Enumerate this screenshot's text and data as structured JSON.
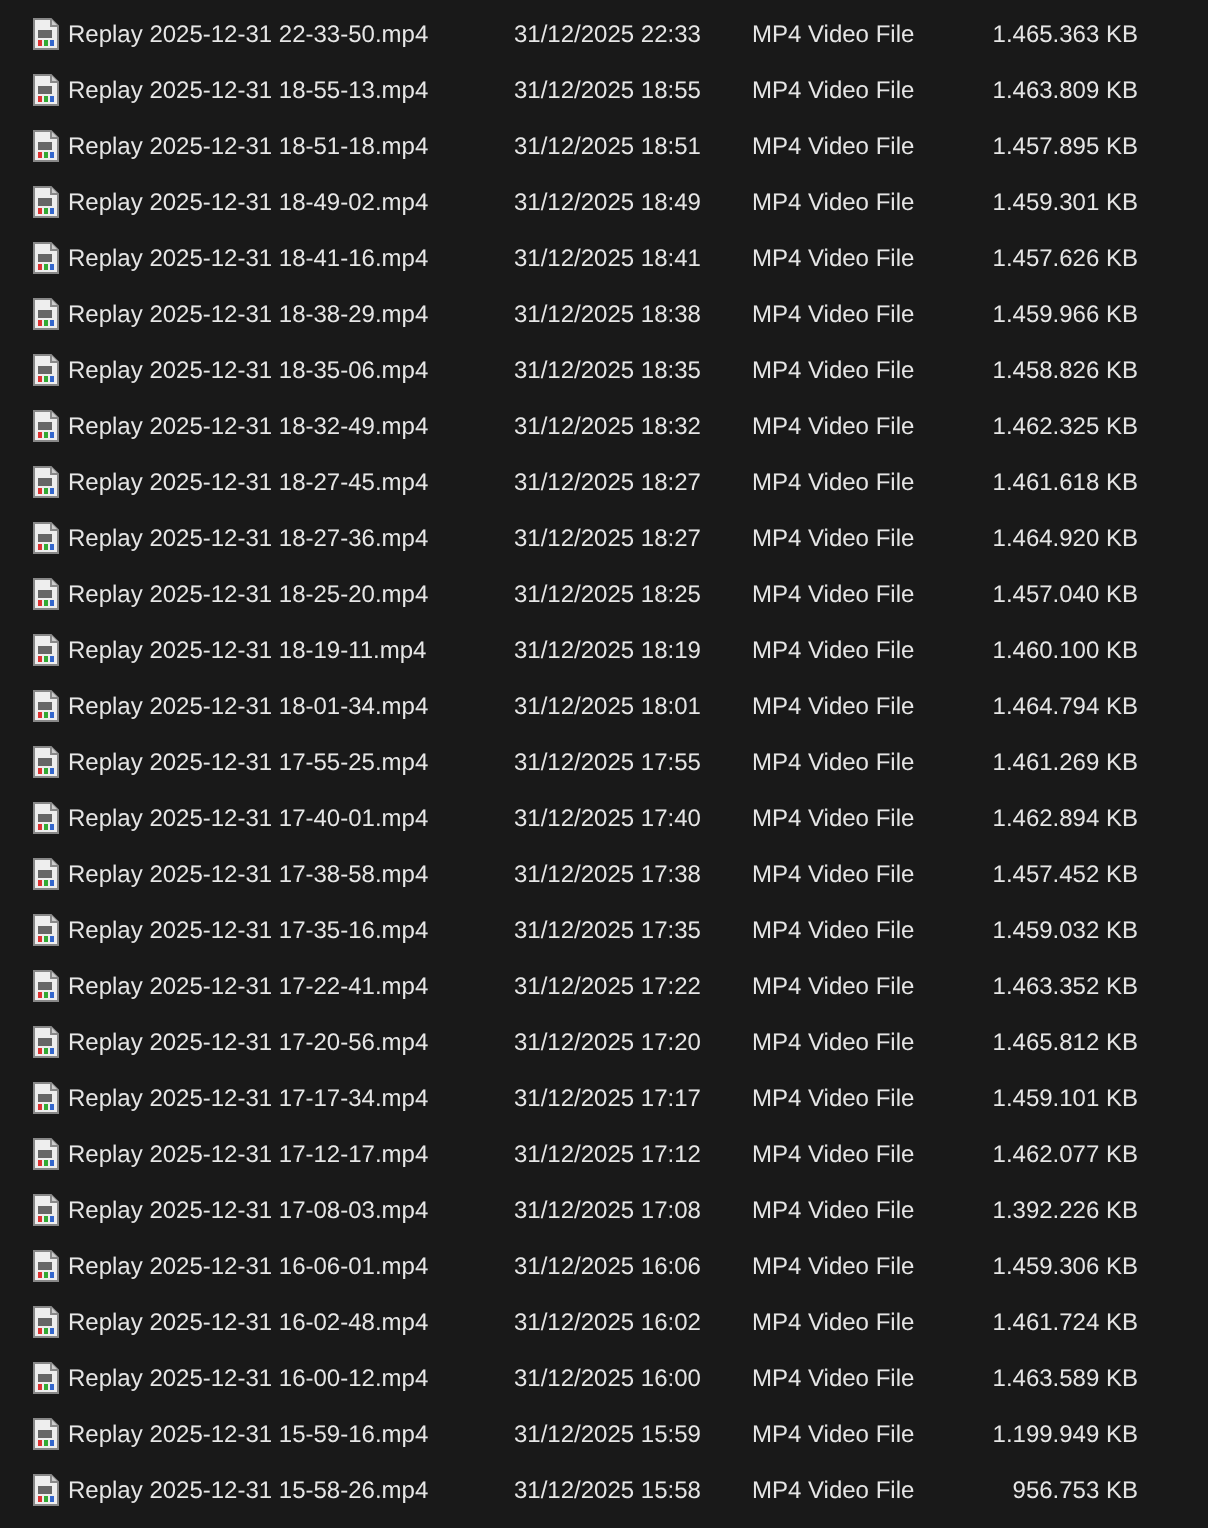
{
  "files": [
    {
      "name": "Replay 2025-12-31 22-33-50.mp4",
      "date_modified": "31/12/2025 22:33",
      "type": "MP4 Video File",
      "size": "1.465.363 KB"
    },
    {
      "name": "Replay 2025-12-31 18-55-13.mp4",
      "date_modified": "31/12/2025 18:55",
      "type": "MP4 Video File",
      "size": "1.463.809 KB"
    },
    {
      "name": "Replay 2025-12-31 18-51-18.mp4",
      "date_modified": "31/12/2025 18:51",
      "type": "MP4 Video File",
      "size": "1.457.895 KB"
    },
    {
      "name": "Replay 2025-12-31 18-49-02.mp4",
      "date_modified": "31/12/2025 18:49",
      "type": "MP4 Video File",
      "size": "1.459.301 KB"
    },
    {
      "name": "Replay 2025-12-31 18-41-16.mp4",
      "date_modified": "31/12/2025 18:41",
      "type": "MP4 Video File",
      "size": "1.457.626 KB"
    },
    {
      "name": "Replay 2025-12-31 18-38-29.mp4",
      "date_modified": "31/12/2025 18:38",
      "type": "MP4 Video File",
      "size": "1.459.966 KB"
    },
    {
      "name": "Replay 2025-12-31 18-35-06.mp4",
      "date_modified": "31/12/2025 18:35",
      "type": "MP4 Video File",
      "size": "1.458.826 KB"
    },
    {
      "name": "Replay 2025-12-31 18-32-49.mp4",
      "date_modified": "31/12/2025 18:32",
      "type": "MP4 Video File",
      "size": "1.462.325 KB"
    },
    {
      "name": "Replay 2025-12-31 18-27-45.mp4",
      "date_modified": "31/12/2025 18:27",
      "type": "MP4 Video File",
      "size": "1.461.618 KB"
    },
    {
      "name": "Replay 2025-12-31 18-27-36.mp4",
      "date_modified": "31/12/2025 18:27",
      "type": "MP4 Video File",
      "size": "1.464.920 KB"
    },
    {
      "name": "Replay 2025-12-31 18-25-20.mp4",
      "date_modified": "31/12/2025 18:25",
      "type": "MP4 Video File",
      "size": "1.457.040 KB"
    },
    {
      "name": "Replay 2025-12-31 18-19-11.mp4",
      "date_modified": "31/12/2025 18:19",
      "type": "MP4 Video File",
      "size": "1.460.100 KB"
    },
    {
      "name": "Replay 2025-12-31 18-01-34.mp4",
      "date_modified": "31/12/2025 18:01",
      "type": "MP4 Video File",
      "size": "1.464.794 KB"
    },
    {
      "name": "Replay 2025-12-31 17-55-25.mp4",
      "date_modified": "31/12/2025 17:55",
      "type": "MP4 Video File",
      "size": "1.461.269 KB"
    },
    {
      "name": "Replay 2025-12-31 17-40-01.mp4",
      "date_modified": "31/12/2025 17:40",
      "type": "MP4 Video File",
      "size": "1.462.894 KB"
    },
    {
      "name": "Replay 2025-12-31 17-38-58.mp4",
      "date_modified": "31/12/2025 17:38",
      "type": "MP4 Video File",
      "size": "1.457.452 KB"
    },
    {
      "name": "Replay 2025-12-31 17-35-16.mp4",
      "date_modified": "31/12/2025 17:35",
      "type": "MP4 Video File",
      "size": "1.459.032 KB"
    },
    {
      "name": "Replay 2025-12-31 17-22-41.mp4",
      "date_modified": "31/12/2025 17:22",
      "type": "MP4 Video File",
      "size": "1.463.352 KB"
    },
    {
      "name": "Replay 2025-12-31 17-20-56.mp4",
      "date_modified": "31/12/2025 17:20",
      "type": "MP4 Video File",
      "size": "1.465.812 KB"
    },
    {
      "name": "Replay 2025-12-31 17-17-34.mp4",
      "date_modified": "31/12/2025 17:17",
      "type": "MP4 Video File",
      "size": "1.459.101 KB"
    },
    {
      "name": "Replay 2025-12-31 17-12-17.mp4",
      "date_modified": "31/12/2025 17:12",
      "type": "MP4 Video File",
      "size": "1.462.077 KB"
    },
    {
      "name": "Replay 2025-12-31 17-08-03.mp4",
      "date_modified": "31/12/2025 17:08",
      "type": "MP4 Video File",
      "size": "1.392.226 KB"
    },
    {
      "name": "Replay 2025-12-31 16-06-01.mp4",
      "date_modified": "31/12/2025 16:06",
      "type": "MP4 Video File",
      "size": "1.459.306 KB"
    },
    {
      "name": "Replay 2025-12-31 16-02-48.mp4",
      "date_modified": "31/12/2025 16:02",
      "type": "MP4 Video File",
      "size": "1.461.724 KB"
    },
    {
      "name": "Replay 2025-12-31 16-00-12.mp4",
      "date_modified": "31/12/2025 16:00",
      "type": "MP4 Video File",
      "size": "1.463.589 KB"
    },
    {
      "name": "Replay 2025-12-31 15-59-16.mp4",
      "date_modified": "31/12/2025 15:59",
      "type": "MP4 Video File",
      "size": "1.199.949 KB"
    },
    {
      "name": "Replay 2025-12-31 15-58-26.mp4",
      "date_modified": "31/12/2025 15:58",
      "type": "MP4 Video File",
      "size": "956.753 KB"
    }
  ]
}
